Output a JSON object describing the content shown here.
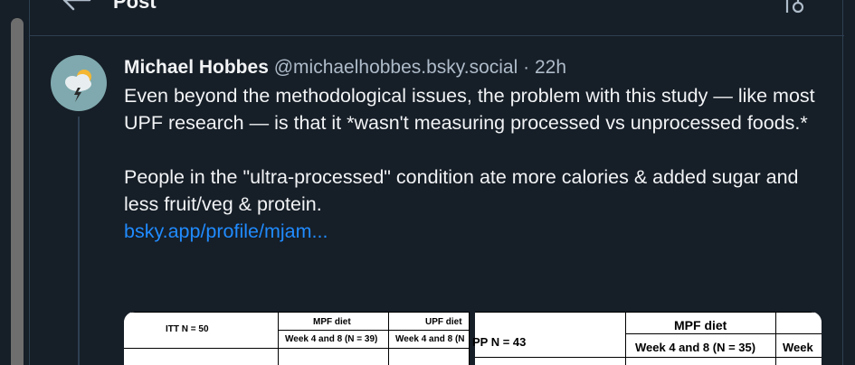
{
  "header": {
    "title": "Post",
    "back_icon": "arrow-left-icon",
    "options_icon": "sliders-icon"
  },
  "post": {
    "author_name": "Michael Hobbes",
    "author_handle": "@michaelhobbes.bsky.social",
    "separator": "·",
    "time": "22h",
    "text": "Even beyond the methodological issues, the problem with this study — like most UPF research — is that it *wasn't measuring processed vs unprocessed foods.*\n\nPeople in the \"ultra-processed\" condition ate more calories & added sugar and less fruit/veg & protein.",
    "link": "bsky.app/profile/mjam..."
  },
  "images": {
    "left_table": {
      "row_label": "ITT N = 50",
      "col1_header": "MPF diet",
      "col2_header": "UPF diet",
      "col1_sub": "Week 4 and 8 (N = 39)",
      "col2_sub": "Week 4 and 8 (N"
    },
    "right_table": {
      "row_label": "PP N = 43",
      "col1_header": "MPF diet",
      "col1_sub": "Week 4 and 8 (N = 35)",
      "col2_sub": "Week"
    }
  },
  "colors": {
    "background": "#161e27",
    "border": "#2e4052",
    "text": "#f1f3f5",
    "muted": "#aebbc9",
    "link": "#208bfe",
    "avatar": "#7fa9ae"
  }
}
